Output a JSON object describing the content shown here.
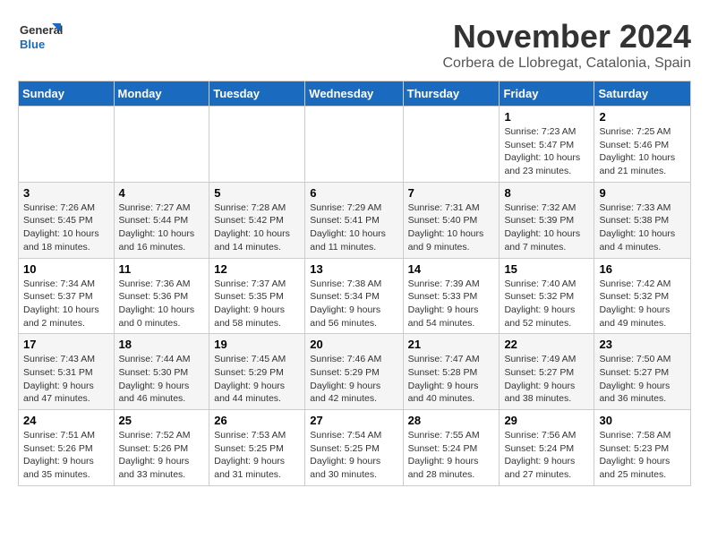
{
  "logo": {
    "line1": "General",
    "line2": "Blue"
  },
  "title": "November 2024",
  "location": "Corbera de Llobregat, Catalonia, Spain",
  "weekdays": [
    "Sunday",
    "Monday",
    "Tuesday",
    "Wednesday",
    "Thursday",
    "Friday",
    "Saturday"
  ],
  "weeks": [
    [
      {
        "day": "",
        "info": ""
      },
      {
        "day": "",
        "info": ""
      },
      {
        "day": "",
        "info": ""
      },
      {
        "day": "",
        "info": ""
      },
      {
        "day": "",
        "info": ""
      },
      {
        "day": "1",
        "info": "Sunrise: 7:23 AM\nSunset: 5:47 PM\nDaylight: 10 hours and 23 minutes."
      },
      {
        "day": "2",
        "info": "Sunrise: 7:25 AM\nSunset: 5:46 PM\nDaylight: 10 hours and 21 minutes."
      }
    ],
    [
      {
        "day": "3",
        "info": "Sunrise: 7:26 AM\nSunset: 5:45 PM\nDaylight: 10 hours and 18 minutes."
      },
      {
        "day": "4",
        "info": "Sunrise: 7:27 AM\nSunset: 5:44 PM\nDaylight: 10 hours and 16 minutes."
      },
      {
        "day": "5",
        "info": "Sunrise: 7:28 AM\nSunset: 5:42 PM\nDaylight: 10 hours and 14 minutes."
      },
      {
        "day": "6",
        "info": "Sunrise: 7:29 AM\nSunset: 5:41 PM\nDaylight: 10 hours and 11 minutes."
      },
      {
        "day": "7",
        "info": "Sunrise: 7:31 AM\nSunset: 5:40 PM\nDaylight: 10 hours and 9 minutes."
      },
      {
        "day": "8",
        "info": "Sunrise: 7:32 AM\nSunset: 5:39 PM\nDaylight: 10 hours and 7 minutes."
      },
      {
        "day": "9",
        "info": "Sunrise: 7:33 AM\nSunset: 5:38 PM\nDaylight: 10 hours and 4 minutes."
      }
    ],
    [
      {
        "day": "10",
        "info": "Sunrise: 7:34 AM\nSunset: 5:37 PM\nDaylight: 10 hours and 2 minutes."
      },
      {
        "day": "11",
        "info": "Sunrise: 7:36 AM\nSunset: 5:36 PM\nDaylight: 10 hours and 0 minutes."
      },
      {
        "day": "12",
        "info": "Sunrise: 7:37 AM\nSunset: 5:35 PM\nDaylight: 9 hours and 58 minutes."
      },
      {
        "day": "13",
        "info": "Sunrise: 7:38 AM\nSunset: 5:34 PM\nDaylight: 9 hours and 56 minutes."
      },
      {
        "day": "14",
        "info": "Sunrise: 7:39 AM\nSunset: 5:33 PM\nDaylight: 9 hours and 54 minutes."
      },
      {
        "day": "15",
        "info": "Sunrise: 7:40 AM\nSunset: 5:32 PM\nDaylight: 9 hours and 52 minutes."
      },
      {
        "day": "16",
        "info": "Sunrise: 7:42 AM\nSunset: 5:32 PM\nDaylight: 9 hours and 49 minutes."
      }
    ],
    [
      {
        "day": "17",
        "info": "Sunrise: 7:43 AM\nSunset: 5:31 PM\nDaylight: 9 hours and 47 minutes."
      },
      {
        "day": "18",
        "info": "Sunrise: 7:44 AM\nSunset: 5:30 PM\nDaylight: 9 hours and 46 minutes."
      },
      {
        "day": "19",
        "info": "Sunrise: 7:45 AM\nSunset: 5:29 PM\nDaylight: 9 hours and 44 minutes."
      },
      {
        "day": "20",
        "info": "Sunrise: 7:46 AM\nSunset: 5:29 PM\nDaylight: 9 hours and 42 minutes."
      },
      {
        "day": "21",
        "info": "Sunrise: 7:47 AM\nSunset: 5:28 PM\nDaylight: 9 hours and 40 minutes."
      },
      {
        "day": "22",
        "info": "Sunrise: 7:49 AM\nSunset: 5:27 PM\nDaylight: 9 hours and 38 minutes."
      },
      {
        "day": "23",
        "info": "Sunrise: 7:50 AM\nSunset: 5:27 PM\nDaylight: 9 hours and 36 minutes."
      }
    ],
    [
      {
        "day": "24",
        "info": "Sunrise: 7:51 AM\nSunset: 5:26 PM\nDaylight: 9 hours and 35 minutes."
      },
      {
        "day": "25",
        "info": "Sunrise: 7:52 AM\nSunset: 5:26 PM\nDaylight: 9 hours and 33 minutes."
      },
      {
        "day": "26",
        "info": "Sunrise: 7:53 AM\nSunset: 5:25 PM\nDaylight: 9 hours and 31 minutes."
      },
      {
        "day": "27",
        "info": "Sunrise: 7:54 AM\nSunset: 5:25 PM\nDaylight: 9 hours and 30 minutes."
      },
      {
        "day": "28",
        "info": "Sunrise: 7:55 AM\nSunset: 5:24 PM\nDaylight: 9 hours and 28 minutes."
      },
      {
        "day": "29",
        "info": "Sunrise: 7:56 AM\nSunset: 5:24 PM\nDaylight: 9 hours and 27 minutes."
      },
      {
        "day": "30",
        "info": "Sunrise: 7:58 AM\nSunset: 5:23 PM\nDaylight: 9 hours and 25 minutes."
      }
    ]
  ]
}
